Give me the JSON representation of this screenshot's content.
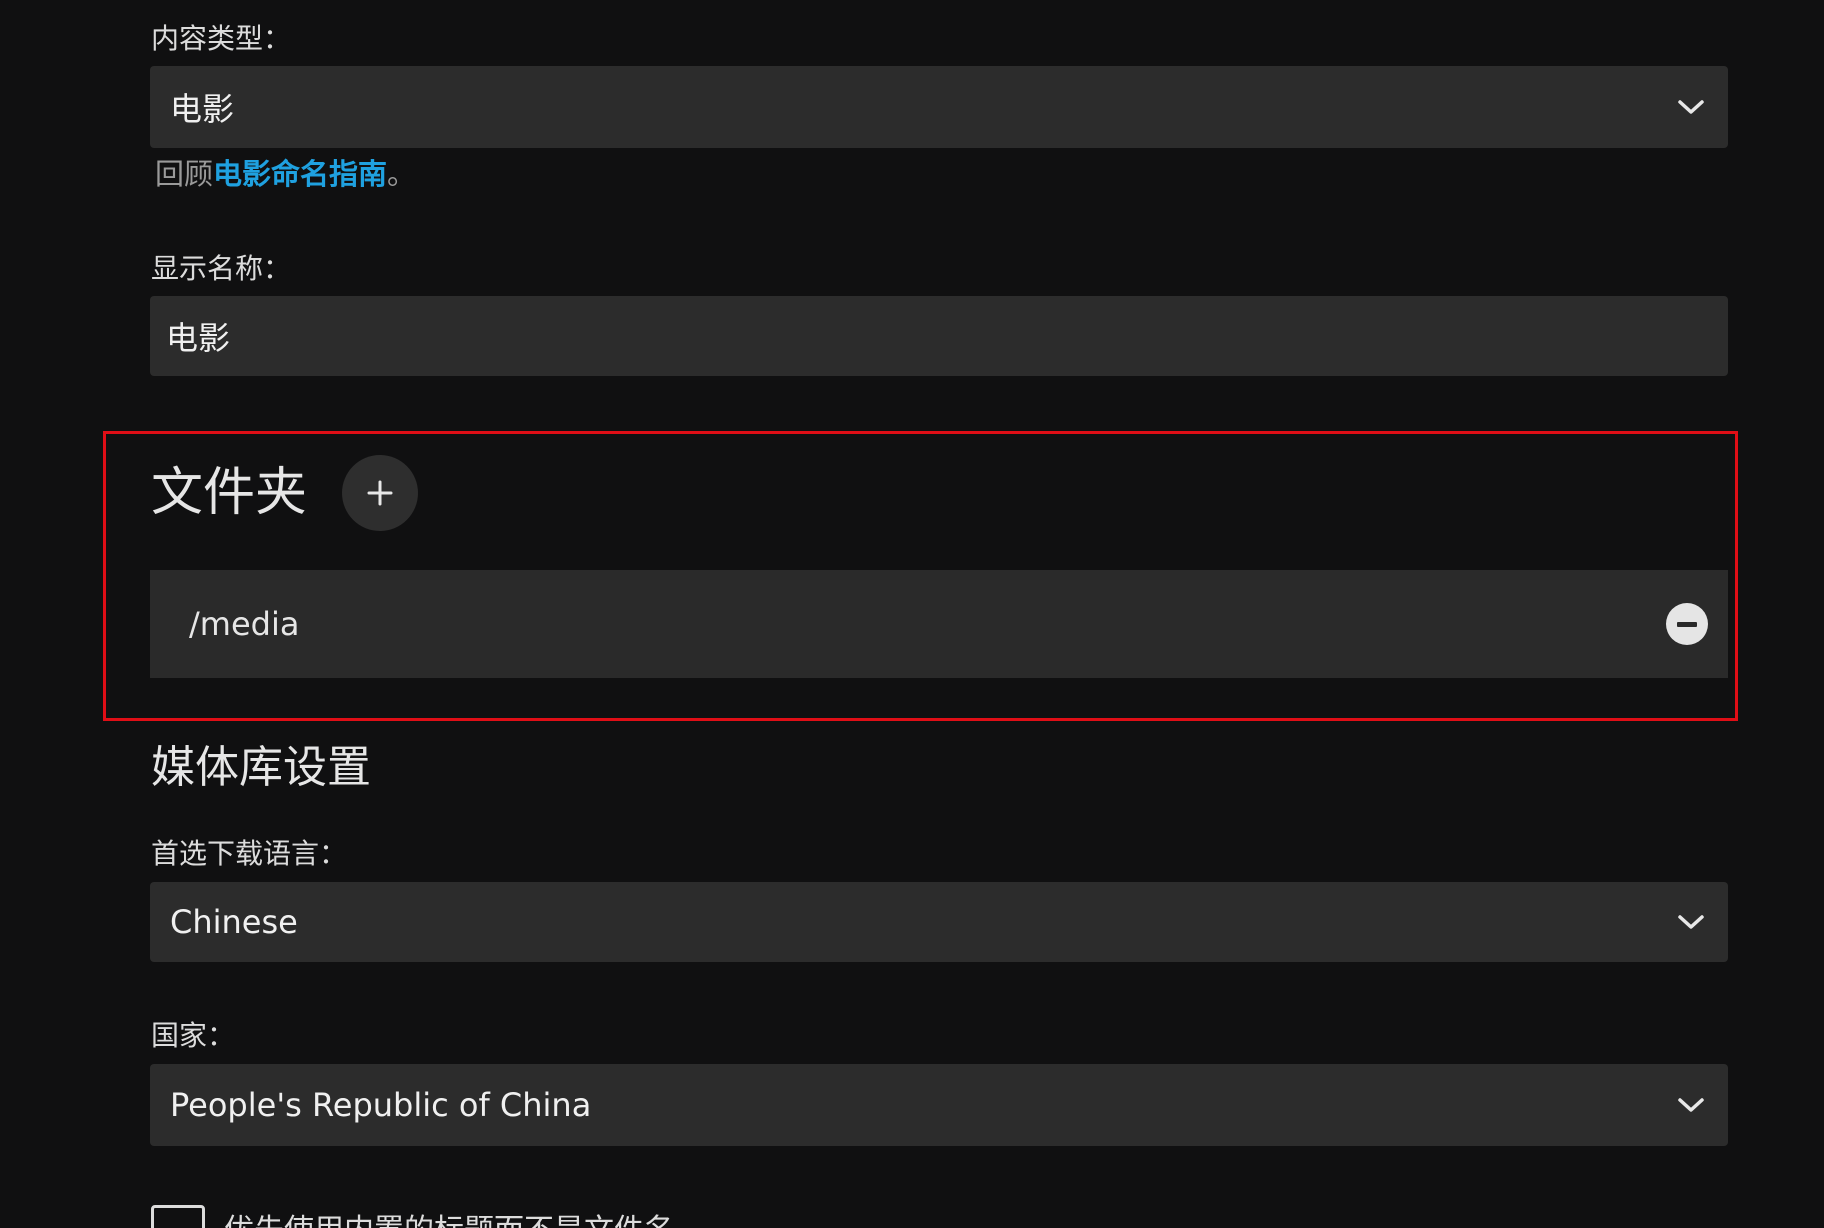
{
  "content_type": {
    "label": "内容类型：",
    "value": "电影"
  },
  "naming_hint": {
    "prefix": "回顾",
    "link": "电影命名指南",
    "suffix": "。"
  },
  "display_name": {
    "label": "显示名称：",
    "value": "电影"
  },
  "folders": {
    "title": "文件夹",
    "add_icon": "plus-icon",
    "items": [
      {
        "path": "/media",
        "remove_icon": "minus-circle-icon"
      }
    ]
  },
  "library_settings": {
    "title": "媒体库设置",
    "preferred_language": {
      "label": "首选下载语言：",
      "value": "Chinese"
    },
    "country": {
      "label": "国家：",
      "value": "People's Republic of China"
    },
    "checkbox": {
      "label": "优先使用内置的标题而不是文件名",
      "checked": false
    }
  },
  "colors": {
    "background": "#101011",
    "field": "#2c2c2c",
    "link": "#1fa1e0",
    "highlight": "#e00e16"
  }
}
